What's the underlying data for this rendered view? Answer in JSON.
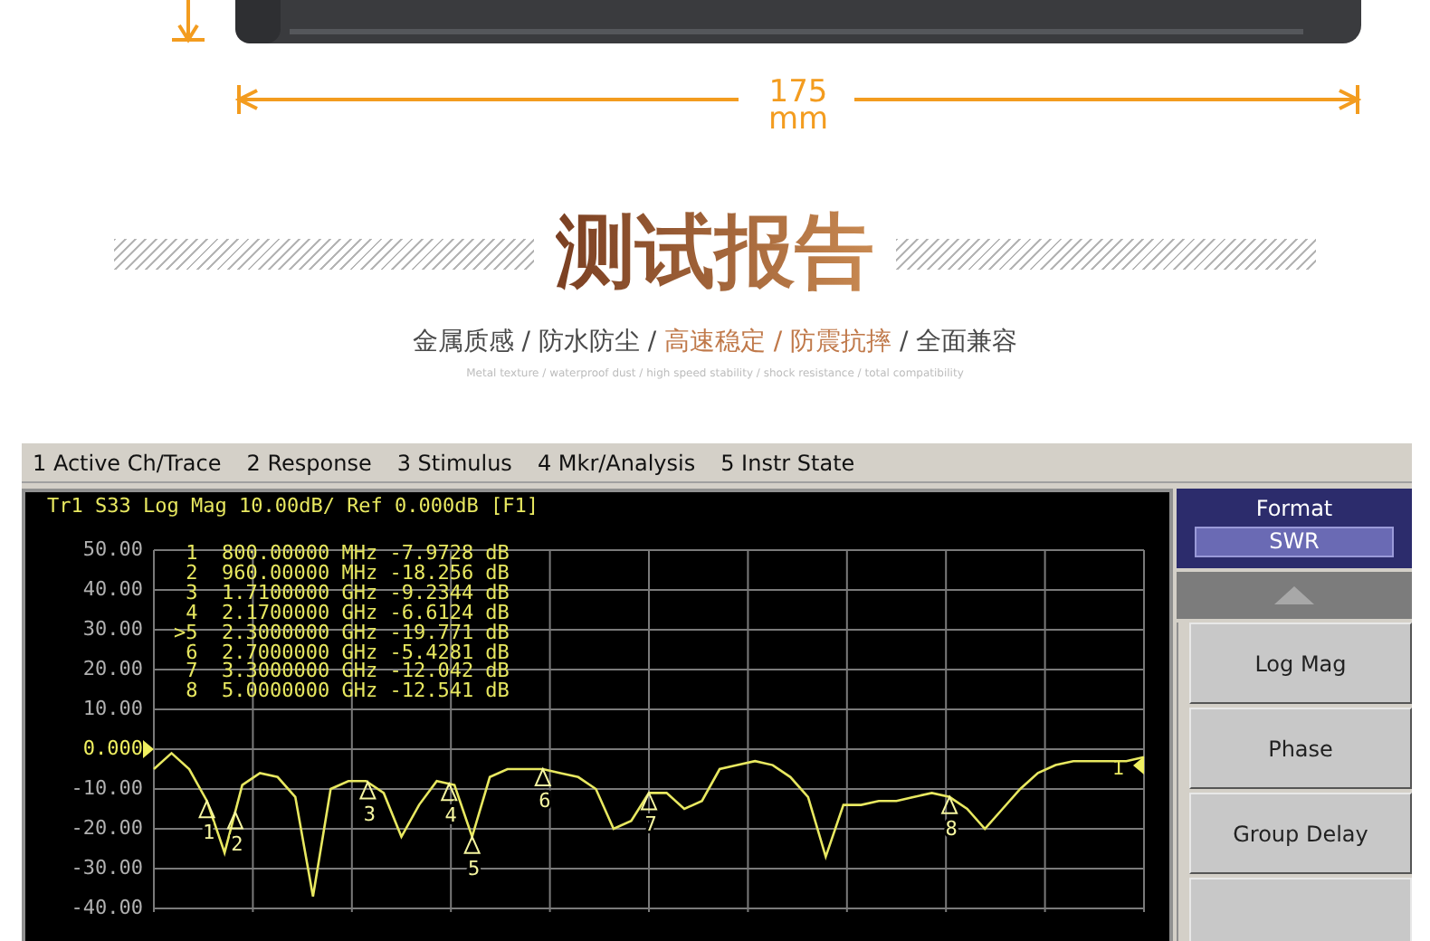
{
  "dimension": {
    "value": "175",
    "unit": "mm"
  },
  "title": "测试报告",
  "subtitle": [
    {
      "text": "金属质感 / 防水防尘 / ",
      "highlight": false
    },
    {
      "text": "高速稳定 / 防震抗摔",
      "highlight": true
    },
    {
      "text": " / 全面兼容",
      "highlight": false
    }
  ],
  "subtitle_en": "Metal texture / waterproof dust / high speed stability / shock resistance / total compatibility",
  "analyzer": {
    "menu": [
      "1 Active Ch/Trace",
      "2 Response",
      "3 Stimulus",
      "4 Mkr/Analysis",
      "5 Instr State"
    ],
    "trace_header": "Tr1 S33 Log Mag 10.00dB/ Ref 0.000dB [F1]",
    "markers": [
      {
        "number": "1",
        "freq": "800.00000 MHz",
        "value": "-7.9728 dB"
      },
      {
        "number": "2",
        "freq": "960.00000 MHz",
        "value": "-18.256 dB"
      },
      {
        "number": "3",
        "freq": "1.7100000 GHz",
        "value": "-9.2344 dB"
      },
      {
        "number": "4",
        "freq": "2.1700000 GHz",
        "value": "-6.6124 dB"
      },
      {
        "number": ">5",
        "freq": "2.3000000 GHz",
        "value": "-19.771 dB"
      },
      {
        "number": "6",
        "freq": "2.7000000 GHz",
        "value": "-5.4281 dB"
      },
      {
        "number": "7",
        "freq": "3.3000000 GHz",
        "value": "-12.042 dB"
      },
      {
        "number": "8",
        "freq": "5.0000000 GHz",
        "value": "-12.541 dB"
      }
    ],
    "ref_label": "1",
    "trace_markers": [
      {
        "text": "1"
      },
      {
        "text": "2"
      },
      {
        "text": "3"
      },
      {
        "text": "4"
      },
      {
        "text": "5"
      },
      {
        "text": "6"
      },
      {
        "text": "7"
      },
      {
        "text": "8"
      }
    ],
    "chart_data": {
      "type": "line",
      "ylim": [
        -40,
        50
      ],
      "grid": true,
      "yticks": [
        {
          "value": 50,
          "label": "50.00"
        },
        {
          "value": 40,
          "label": "40.00"
        },
        {
          "value": 30,
          "label": "30.00"
        },
        {
          "value": 20,
          "label": "20.00"
        },
        {
          "value": 10,
          "label": "10.00"
        },
        {
          "value": 0,
          "label": "0.000"
        },
        {
          "value": -10,
          "label": "-10.00"
        },
        {
          "value": -20,
          "label": "-20.00"
        },
        {
          "value": -30,
          "label": "-30.00"
        },
        {
          "value": -40,
          "label": "-40.00"
        }
      ],
      "categories": [
        null,
        null,
        null,
        null,
        null,
        null,
        null,
        null,
        null,
        null,
        null,
        null,
        null,
        null,
        null,
        null,
        null,
        null,
        null,
        null,
        null,
        null,
        null,
        null,
        null,
        null,
        null,
        null,
        null,
        null,
        null,
        null,
        null,
        null,
        null,
        null,
        null,
        null,
        null,
        null,
        null,
        null,
        null,
        null,
        null,
        null,
        null,
        null,
        null,
        null,
        null,
        null,
        null,
        null,
        null,
        null,
        null
      ],
      "series": [
        {
          "color": "#e8e860",
          "values": [
            -5,
            -1,
            -5,
            -13,
            -26,
            -9,
            -6,
            -7,
            -12,
            -37,
            -10,
            -8,
            -8,
            -11,
            -22,
            -14,
            -8,
            -9,
            -22,
            -7,
            -5,
            -5,
            -5,
            -6,
            -7,
            -10,
            -20,
            -18,
            -11,
            -11,
            -15,
            -13,
            -5,
            -4,
            -3,
            -4,
            -7,
            -12,
            -27,
            -14,
            -14,
            -13,
            -13,
            -12,
            -11,
            -12,
            -15,
            -20,
            -15,
            -10,
            -6,
            -4,
            -3,
            -3,
            -3,
            -3,
            -2
          ]
        }
      ]
    },
    "softkeys": {
      "title": "Format",
      "value": "SWR",
      "buttons": [
        "Log Mag",
        "Phase",
        "Group Delay"
      ]
    }
  }
}
